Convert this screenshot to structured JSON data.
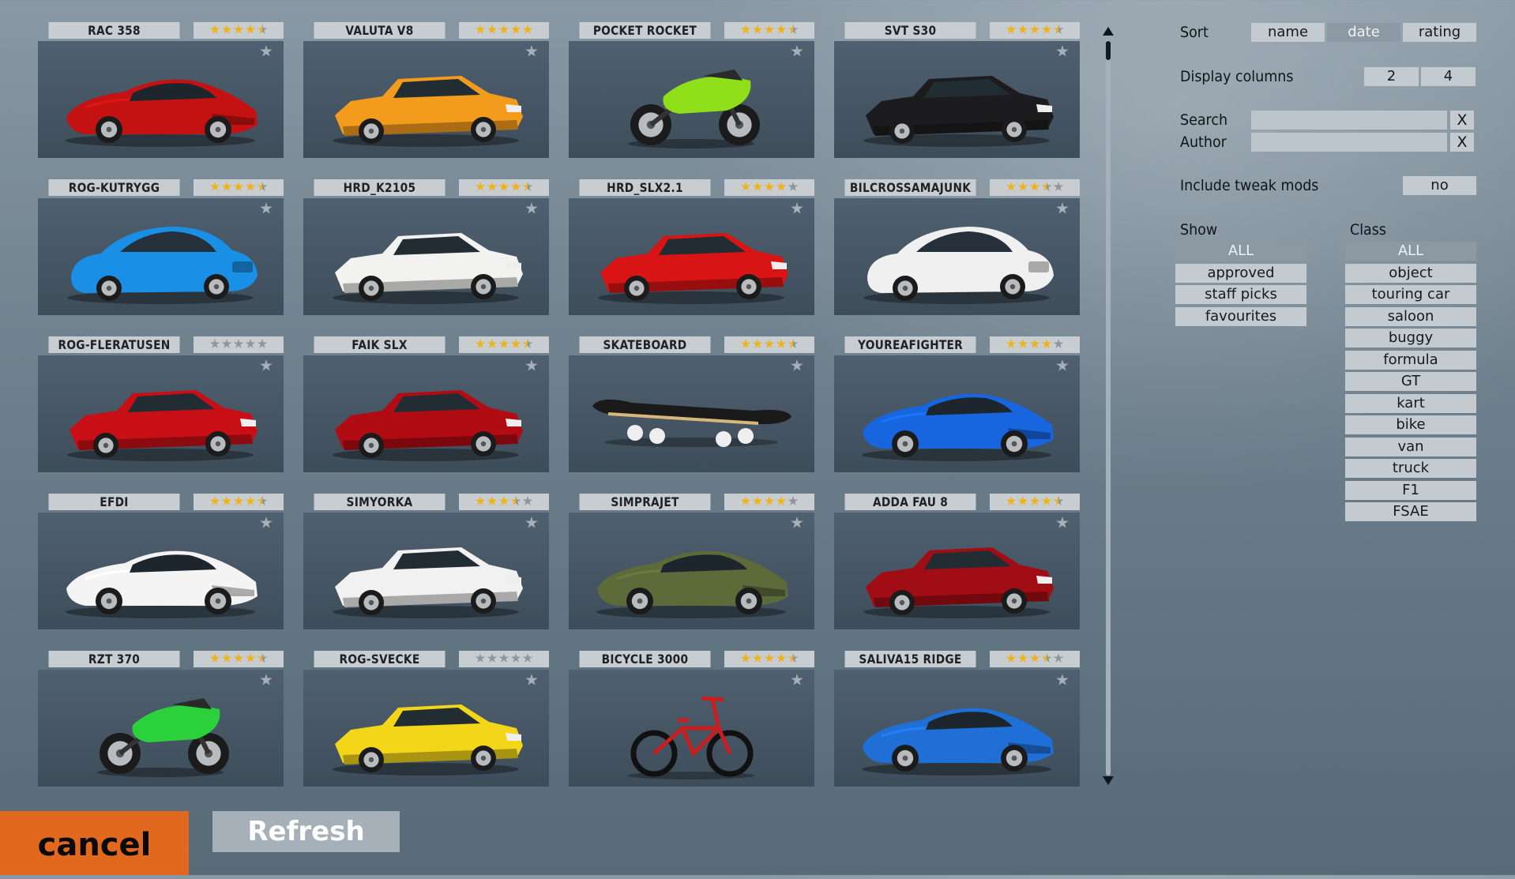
{
  "cards": [
    {
      "name": "RAC 358",
      "rating": 4.5,
      "color": "#c41212",
      "shape": "sportscar"
    },
    {
      "name": "VALUTA V8",
      "rating": 5,
      "color": "#f39b1c",
      "shape": "sedan"
    },
    {
      "name": "POCKET ROCKET",
      "rating": 4.5,
      "color": "#8fe01a",
      "shape": "motorbike"
    },
    {
      "name": "SVT S30",
      "rating": 4.5,
      "color": "#1c1c1e",
      "shape": "sedan"
    },
    {
      "name": "ROG-KUTRYGG",
      "rating": 4.5,
      "color": "#1a8fe6",
      "shape": "coupe"
    },
    {
      "name": "HRD_K2105",
      "rating": 4.5,
      "color": "#f2f2f0",
      "shape": "sedan"
    },
    {
      "name": "HRD_SLX2.1",
      "rating": 4,
      "color": "#d91414",
      "shape": "hatch"
    },
    {
      "name": "BILCROSSAMAJUNK",
      "rating": 3.5,
      "color": "#f0f0f0",
      "shape": "coupe"
    },
    {
      "name": "ROG-FLERATUSEN",
      "rating": 0,
      "color": "#c80f16",
      "shape": "sedan"
    },
    {
      "name": "FAIK SLX",
      "rating": 4.5,
      "color": "#b10c14",
      "shape": "sedan"
    },
    {
      "name": "SKATEBOARD",
      "rating": 4.5,
      "color": "#d8b77a",
      "shape": "skateboard"
    },
    {
      "name": "YOUREAFIGHTER",
      "rating": 4,
      "color": "#1766e0",
      "shape": "sportscar"
    },
    {
      "name": "EFDI",
      "rating": 4.5,
      "color": "#f4f4f4",
      "shape": "sportscar"
    },
    {
      "name": "SIMYORKA",
      "rating": 3.5,
      "color": "#f1f1f1",
      "shape": "sedan"
    },
    {
      "name": "SIMPRAJET",
      "rating": 4,
      "color": "#5d6b3a",
      "shape": "sportscar"
    },
    {
      "name": "ADDA FAU 8",
      "rating": 4.5,
      "color": "#a10d14",
      "shape": "sedan"
    },
    {
      "name": "RZT 370",
      "rating": 4.5,
      "color": "#2bd13a",
      "shape": "motorbike"
    },
    {
      "name": "ROG-SVECKE",
      "rating": 0,
      "color": "#f3d51a",
      "shape": "sedan"
    },
    {
      "name": "BICYCLE 3000",
      "rating": 4.5,
      "color": "#c81e1e",
      "shape": "bicycle"
    },
    {
      "name": "SALIVA15 RIDGE",
      "rating": 3.5,
      "color": "#1f6fd6",
      "shape": "sportscar"
    }
  ],
  "panel": {
    "sort_label": "Sort",
    "sort_options": [
      "name",
      "date",
      "rating"
    ],
    "sort_selected": "date",
    "columns_label": "Display columns",
    "columns_options": [
      "2",
      "4"
    ],
    "search_label": "Search",
    "search_value": "",
    "author_label": "Author",
    "author_value": "",
    "clear_label": "X",
    "tweak_label": "Include tweak mods",
    "tweak_value": "no",
    "show_label": "Show",
    "show_options": [
      "ALL",
      "approved",
      "staff picks",
      "favourites"
    ],
    "show_selected": "ALL",
    "class_label": "Class",
    "class_options": [
      "ALL",
      "object",
      "touring car",
      "saloon",
      "buggy",
      "formula",
      "GT",
      "kart",
      "bike",
      "van",
      "truck",
      "F1",
      "FSAE"
    ],
    "class_selected": "ALL"
  },
  "buttons": {
    "cancel": "cancel",
    "refresh": "Refresh"
  },
  "colors": {
    "accent": "#e0681f",
    "star": "#f0b21b"
  }
}
